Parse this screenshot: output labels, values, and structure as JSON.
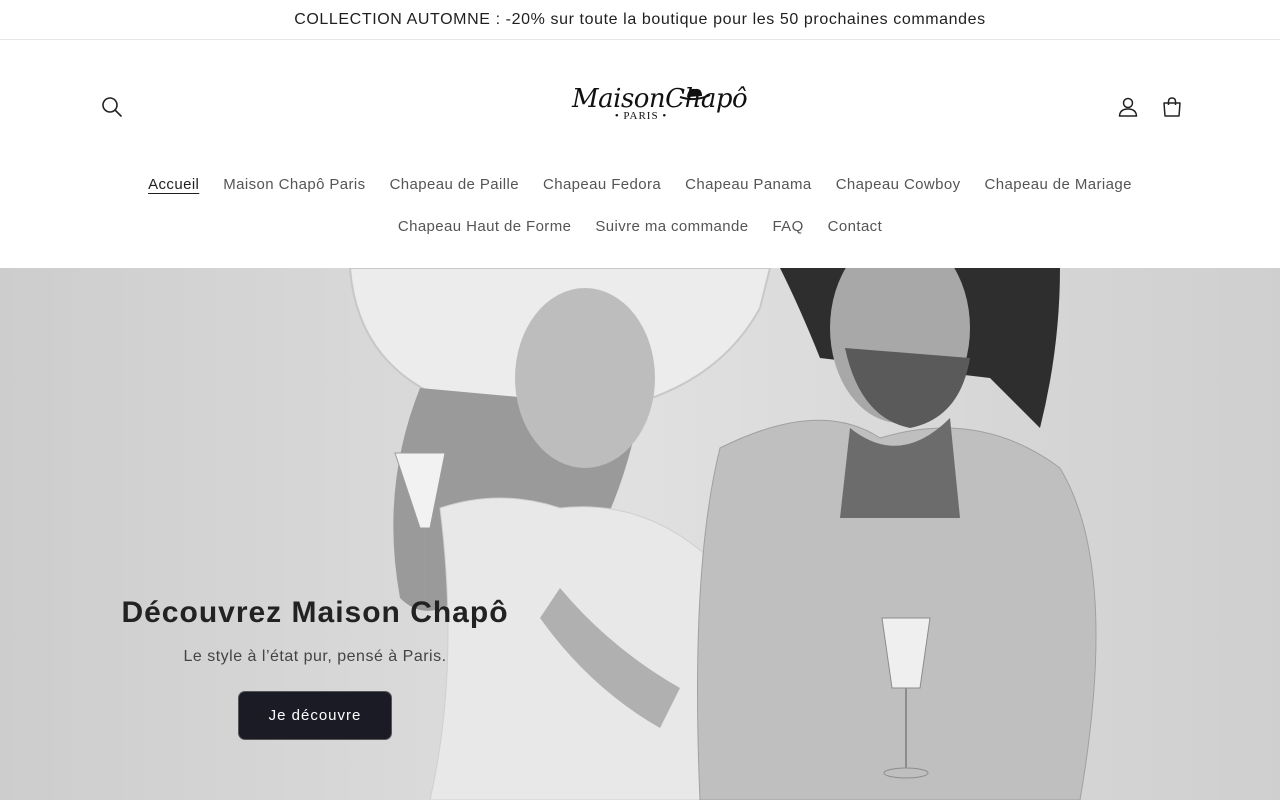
{
  "announcement": {
    "text": "COLLECTION AUTOMNE : -20% sur toute la boutique pour les 50 prochaines commandes"
  },
  "header": {
    "logo": {
      "name": "MaisonChapô",
      "tagline": "• PARIS •"
    },
    "icons": {
      "search": "search-icon",
      "account": "account-icon",
      "cart": "cart-icon"
    }
  },
  "nav": {
    "row1": [
      {
        "label": "Accueil",
        "active": true
      },
      {
        "label": "Maison Chapô Paris",
        "active": false
      },
      {
        "label": "Chapeau de Paille",
        "active": false
      },
      {
        "label": "Chapeau Fedora",
        "active": false
      },
      {
        "label": "Chapeau Panama",
        "active": false
      },
      {
        "label": "Chapeau Cowboy",
        "active": false
      },
      {
        "label": "Chapeau de Mariage",
        "active": false
      }
    ],
    "row2": [
      {
        "label": "Chapeau Haut de Forme",
        "active": false
      },
      {
        "label": "Suivre ma commande",
        "active": false
      },
      {
        "label": "FAQ",
        "active": false
      },
      {
        "label": "Contact",
        "active": false
      }
    ]
  },
  "hero": {
    "title": "Découvrez Maison Chapô",
    "subtitle": "Le style à l’état pur, pensé à Paris.",
    "button_label": "Je découvre"
  },
  "colors": {
    "button_bg": "#1b1b26",
    "hero_bg": "#d9d9d9",
    "text": "#1f1f1f"
  }
}
